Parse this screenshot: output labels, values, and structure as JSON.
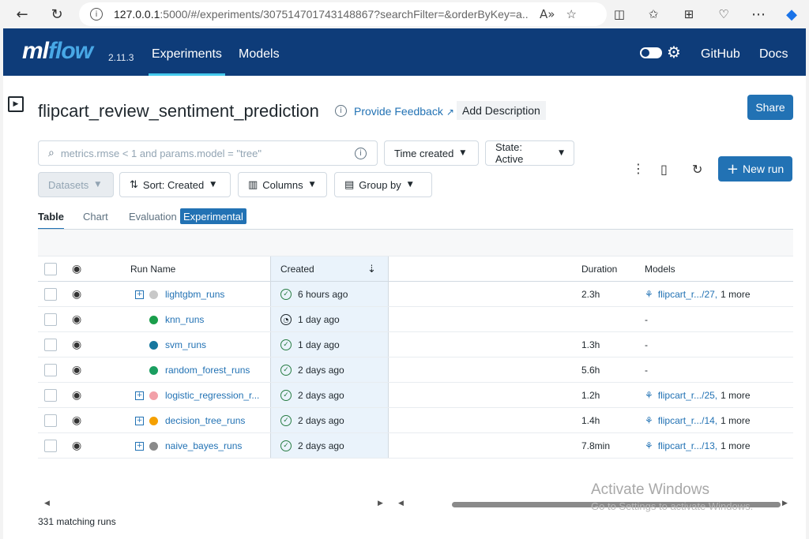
{
  "browser": {
    "url_host": "127.0.0.1",
    "url_path": ":5000/#/experiments/307514701743148867?searchFilter=&orderByKey=a..."
  },
  "header": {
    "logo_ml": "ml",
    "logo_flow": "flow",
    "version": "2.11.3",
    "nav": [
      "Experiments",
      "Models"
    ],
    "links": [
      "GitHub",
      "Docs"
    ]
  },
  "experiment": {
    "title": "flipcart_review_sentiment_prediction",
    "feedback_label": "Provide Feedback",
    "add_description_label": "Add Description",
    "share_label": "Share"
  },
  "controls": {
    "search_placeholder": "metrics.rmse < 1 and params.model = \"tree\"",
    "time_created_label": "Time created",
    "state_label": "State: Active",
    "datasets_label": "Datasets",
    "sort_label": "Sort: Created",
    "columns_label": "Columns",
    "group_by_label": "Group by",
    "new_run_label": "New run"
  },
  "tabs": [
    "Table",
    "Chart",
    "Evaluation",
    "Experimental"
  ],
  "table": {
    "columns": {
      "run_name": "Run Name",
      "created": "Created",
      "duration": "Duration",
      "models": "Models"
    },
    "rows": [
      {
        "name": "lightgbm_runs",
        "parent": true,
        "color": "#c8c8c8",
        "status": "finished",
        "created": "6 hours ago",
        "duration": "2.3h",
        "model": "flipcart_r.../27,",
        "more": "1 more"
      },
      {
        "name": "knn_runs",
        "parent": false,
        "color": "#1a9e4b",
        "status": "running",
        "created": "1 day ago",
        "duration": "",
        "model": "-",
        "more": ""
      },
      {
        "name": "svm_runs",
        "parent": false,
        "color": "#16779e",
        "status": "finished",
        "created": "1 day ago",
        "duration": "1.3h",
        "model": "-",
        "more": ""
      },
      {
        "name": "random_forest_runs",
        "parent": false,
        "color": "#1a9e60",
        "status": "finished",
        "created": "2 days ago",
        "duration": "5.6h",
        "model": "-",
        "more": ""
      },
      {
        "name": "logistic_regression_r...",
        "parent": true,
        "color": "#f2a0a8",
        "status": "finished",
        "created": "2 days ago",
        "duration": "1.2h",
        "model": "flipcart_r.../25,",
        "more": "1 more"
      },
      {
        "name": "decision_tree_runs",
        "parent": true,
        "color": "#f5a000",
        "status": "finished",
        "created": "2 days ago",
        "duration": "1.4h",
        "model": "flipcart_r.../14,",
        "more": "1 more"
      },
      {
        "name": "naive_bayes_runs",
        "parent": true,
        "color": "#8a8a8a",
        "status": "finished",
        "created": "2 days ago",
        "duration": "7.8min",
        "model": "flipcart_r.../13,",
        "more": "1 more"
      }
    ]
  },
  "footer": {
    "matching_runs": "331 matching runs"
  },
  "watermark": {
    "line1": "Activate Windows",
    "line2": "Go to Settings to activate Windows."
  }
}
